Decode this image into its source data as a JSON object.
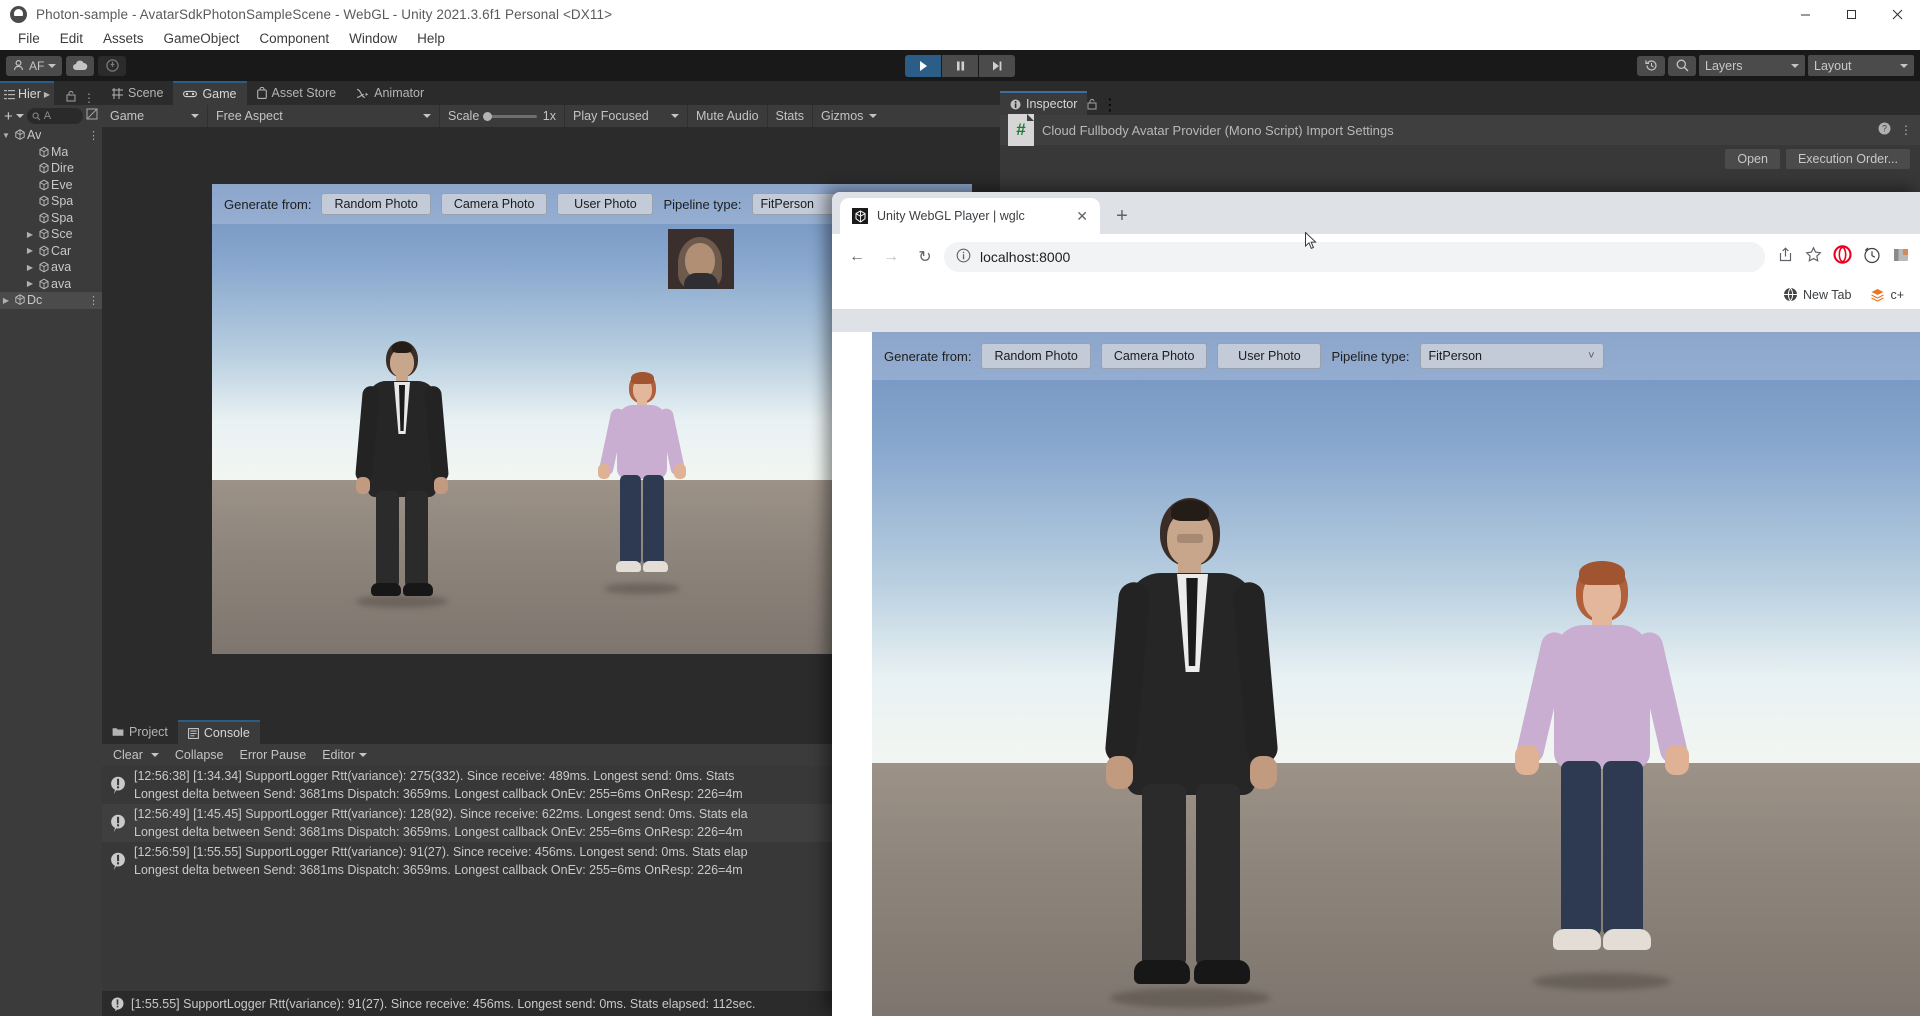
{
  "window": {
    "title": "Photon-sample - AvatarSdkPhotonSampleScene - WebGL - Unity 2021.3.6f1 Personal <DX11>",
    "minimize_label": "Minimize",
    "maximize_label": "Maximize",
    "close_label": "Close"
  },
  "menubar": {
    "items": [
      "File",
      "Edit",
      "Assets",
      "GameObject",
      "Component",
      "Window",
      "Help"
    ]
  },
  "unity_toolbar": {
    "account_label": "AF",
    "cloud_icon": "cloud-icon",
    "collab_icon": "collab-icon",
    "play_icon": "play-icon",
    "pause_icon": "pause-icon",
    "step_icon": "step-icon",
    "undo_history_icon": "history-icon",
    "search_icon": "search-icon",
    "layers_label": "Layers",
    "layout_label": "Layout"
  },
  "left_panel": {
    "tab_label": "Hier",
    "lock_icon": "lock-icon",
    "kebab_icon": "kebab-icon",
    "search_placeholder": "A",
    "hierarchy": [
      {
        "label": "Av",
        "indent": 0,
        "twisty": "down",
        "icon": "unity-icon",
        "selected": false,
        "kebab": true
      },
      {
        "label": "Ma",
        "indent": 2,
        "twisty": "",
        "icon": "cube-icon",
        "selected": false,
        "kebab": false
      },
      {
        "label": "Dire",
        "indent": 2,
        "twisty": "",
        "icon": "cube-icon",
        "selected": false,
        "kebab": false
      },
      {
        "label": "Eve",
        "indent": 2,
        "twisty": "",
        "icon": "cube-icon",
        "selected": false,
        "kebab": false
      },
      {
        "label": "Spa",
        "indent": 2,
        "twisty": "",
        "icon": "cube-icon",
        "selected": false,
        "kebab": false
      },
      {
        "label": "Spa",
        "indent": 2,
        "twisty": "",
        "icon": "cube-icon",
        "selected": false,
        "kebab": false
      },
      {
        "label": "Sce",
        "indent": 2,
        "twisty": "right",
        "icon": "cube-icon",
        "selected": false,
        "kebab": false
      },
      {
        "label": "Car",
        "indent": 2,
        "twisty": "right",
        "icon": "cube-icon",
        "selected": false,
        "kebab": false
      },
      {
        "label": "ava",
        "indent": 2,
        "twisty": "right",
        "icon": "cube-icon",
        "selected": false,
        "kebab": false
      },
      {
        "label": "ava",
        "indent": 2,
        "twisty": "right",
        "icon": "cube-icon",
        "selected": false,
        "kebab": false
      },
      {
        "label": "Dc",
        "indent": 0,
        "twisty": "right",
        "icon": "unity-icon",
        "selected": true,
        "kebab": true
      }
    ]
  },
  "center_tabs": [
    {
      "label": "Scene",
      "icon": "scene-grid-icon",
      "active": false
    },
    {
      "label": "Game",
      "icon": "gamepad-icon",
      "active": true
    },
    {
      "label": "Asset Store",
      "icon": "store-icon",
      "active": false
    },
    {
      "label": "Animator",
      "icon": "animator-icon",
      "active": false
    }
  ],
  "game_toolbar": {
    "display_label": "Game",
    "aspect_label": "Free Aspect",
    "scale_label": "Scale",
    "scale_value": "1x",
    "play_mode_label": "Play Focused",
    "mute_label": "Mute Audio",
    "stats_label": "Stats",
    "gizmos_label": "Gizmos"
  },
  "webgl_ui": {
    "generate_from_label": "Generate from:",
    "buttons": [
      "Random Photo",
      "Camera Photo",
      "User Photo"
    ],
    "pipeline_label": "Pipeline type:",
    "pipeline_value": "FitPerson"
  },
  "bottom_tabs": [
    {
      "label": "Project",
      "icon": "folder-icon",
      "active": false
    },
    {
      "label": "Console",
      "icon": "console-icon",
      "active": true
    }
  ],
  "console_toolbar": {
    "clear_label": "Clear",
    "collapse_label": "Collapse",
    "error_pause_label": "Error Pause",
    "editor_label": "Editor",
    "search_placeholder": ""
  },
  "console_rows": [
    {
      "icon": "warning-icon",
      "line1": "[12:56:38] [1:34.34] SupportLogger Rtt(variance): 275(332). Since receive: 489ms. Longest send: 0ms. Stats",
      "line2": "Longest delta between Send: 3681ms Dispatch: 3659ms. Longest callback OnEv: 255=6ms OnResp: 226=4m"
    },
    {
      "icon": "warning-icon",
      "line1": "[12:56:49] [1:45.45] SupportLogger Rtt(variance): 128(92). Since receive: 622ms. Longest send: 0ms. Stats ela",
      "line2": "Longest delta between Send: 3681ms Dispatch: 3659ms. Longest callback OnEv: 255=6ms OnResp: 226=4m"
    },
    {
      "icon": "warning-icon",
      "line1": "[12:56:59] [1:55.55] SupportLogger Rtt(variance): 91(27). Since receive: 456ms. Longest send: 0ms. Stats elap",
      "line2": "Longest delta between Send: 3681ms Dispatch: 3659ms. Longest callback OnEv: 255=6ms OnResp: 226=4m"
    }
  ],
  "statusbar": {
    "icon": "warning-icon",
    "text": "[1:55.55] SupportLogger Rtt(variance): 91(27). Since receive: 456ms. Longest send: 0ms. Stats elapsed: 112sec."
  },
  "inspector": {
    "tab_label": "Inspector",
    "tab_icon": "info-icon",
    "lock_icon": "lock-icon",
    "kebab_icon": "kebab-icon",
    "title": "Cloud Fullbody Avatar Provider (Mono Script) Import Settings",
    "script_icon": "csharp-script-icon",
    "help_icon": "help-icon",
    "menu_icon": "kebab-icon",
    "open_label": "Open",
    "execution_order_label": "Execution Order..."
  },
  "browser": {
    "tab_title": "Unity WebGL Player | wglc",
    "tab_favicon": "unity-icon",
    "close_tab_icon": "close-icon",
    "new_tab_icon": "plus-icon",
    "back_icon": "back-arrow-icon",
    "forward_icon": "forward-arrow-icon",
    "reload_icon": "reload-icon",
    "site_info_icon": "info-circle-icon",
    "url": "localhost:8000",
    "share_icon": "share-icon",
    "bookmark_icon": "star-icon",
    "opera_icon": "opera-icon",
    "history_icon": "clock-icon",
    "extension_icon": "extension-icon",
    "bookmarks": [
      {
        "label": "New Tab",
        "icon": "globe-icon"
      },
      {
        "label": "c+",
        "icon": "stack-icon"
      }
    ]
  },
  "colors": {
    "unity_bg": "#383838",
    "unity_dark": "#2b2b2b",
    "unity_panel": "#3b3b3b",
    "accent_blue": "#2c5d87",
    "chrome_bg": "#dee1e6",
    "ui_button": "#c3cbd8"
  }
}
